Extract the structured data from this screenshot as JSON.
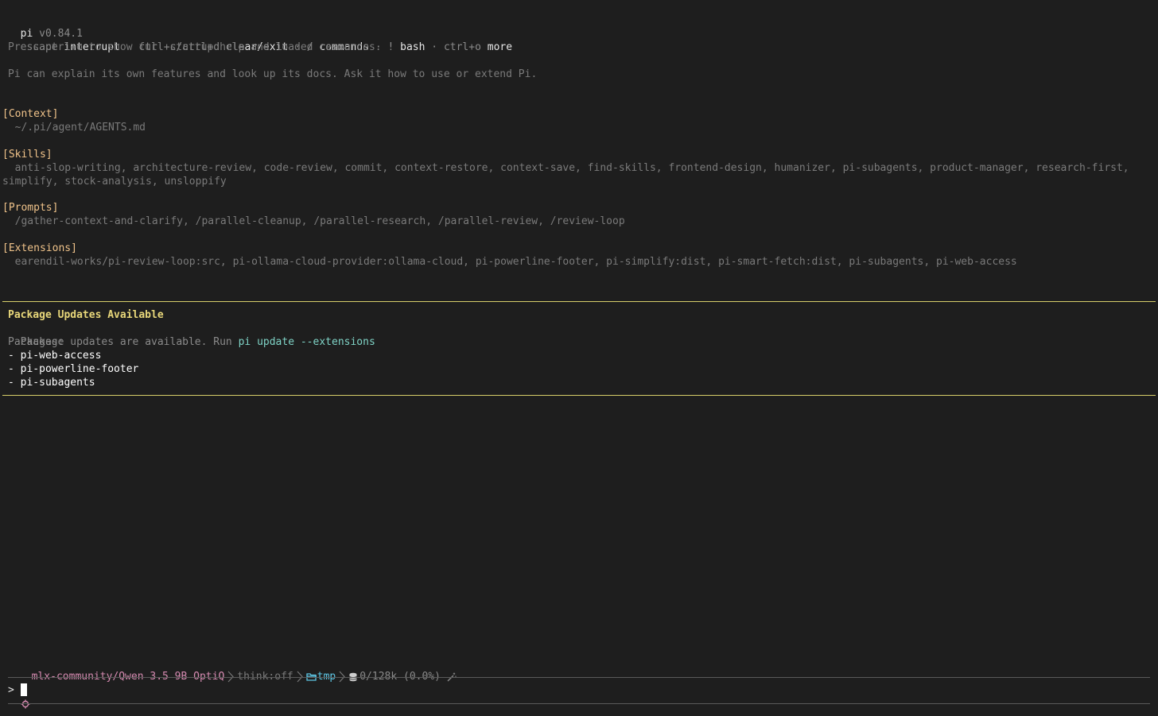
{
  "header": {
    "app_name": "pi",
    "version": "v0.84.1",
    "keys": [
      {
        "key": "escape",
        "action": "interrupt"
      },
      {
        "key": "ctrl+c/ctrl+d",
        "action": "clear/exit"
      },
      {
        "key": "/",
        "action": "commands"
      },
      {
        "key": "!",
        "action": "bash"
      },
      {
        "key": "ctrl+o",
        "action": "more"
      }
    ],
    "separator": " · ",
    "startup_hint": "Press ctrl+o to show full startup help and loaded resources.",
    "info": "Pi can explain its own features and look up its docs. Ask it how to use or extend Pi."
  },
  "context": {
    "label": "[Context]",
    "value": "  ~/.pi/agent/AGENTS.md"
  },
  "skills": {
    "label": "[Skills]",
    "line1": "  anti-slop-writing, architecture-review, code-review, commit, context-restore, context-save, find-skills, frontend-design, humanizer, pi-subagents, product-manager, research-first,",
    "line2": "simplify, stock-analysis, unsloppify"
  },
  "prompts": {
    "label": "[Prompts]",
    "value": "  /gather-context-and-clarify, /parallel-cleanup, /parallel-research, /parallel-review, /review-loop"
  },
  "extensions": {
    "label": "[Extensions]",
    "value": "  earendil-works/pi-review-loop:src, pi-ollama-cloud-provider:ollama-cloud, pi-powerline-footer, pi-simplify:dist, pi-smart-fetch:dist, pi-subagents, pi-web-access"
  },
  "updates": {
    "title": "Package Updates Available",
    "message_prefix": "Package updates are available. Run ",
    "command": "pi update --extensions",
    "packages_label": "Packages:",
    "packages": [
      "- pi-web-access",
      "- pi-powerline-footer",
      "- pi-subagents"
    ]
  },
  "status_bar": {
    "model": "mlx-community/Qwen 3.5 9B OptiQ",
    "think": "think:off",
    "folder": "tmp",
    "tokens": "0/128k (0.0%)",
    "icons": [
      "gear-icon",
      "chevron-right-icon",
      "folder-icon",
      "database-icon",
      "wand-icon"
    ],
    "colors": {
      "model": "#d58ab0",
      "folder": "#5ec8e6",
      "accent": "#d7cf6a"
    }
  },
  "prompt_input": {
    "prompt_symbol": ">",
    "value": ""
  }
}
